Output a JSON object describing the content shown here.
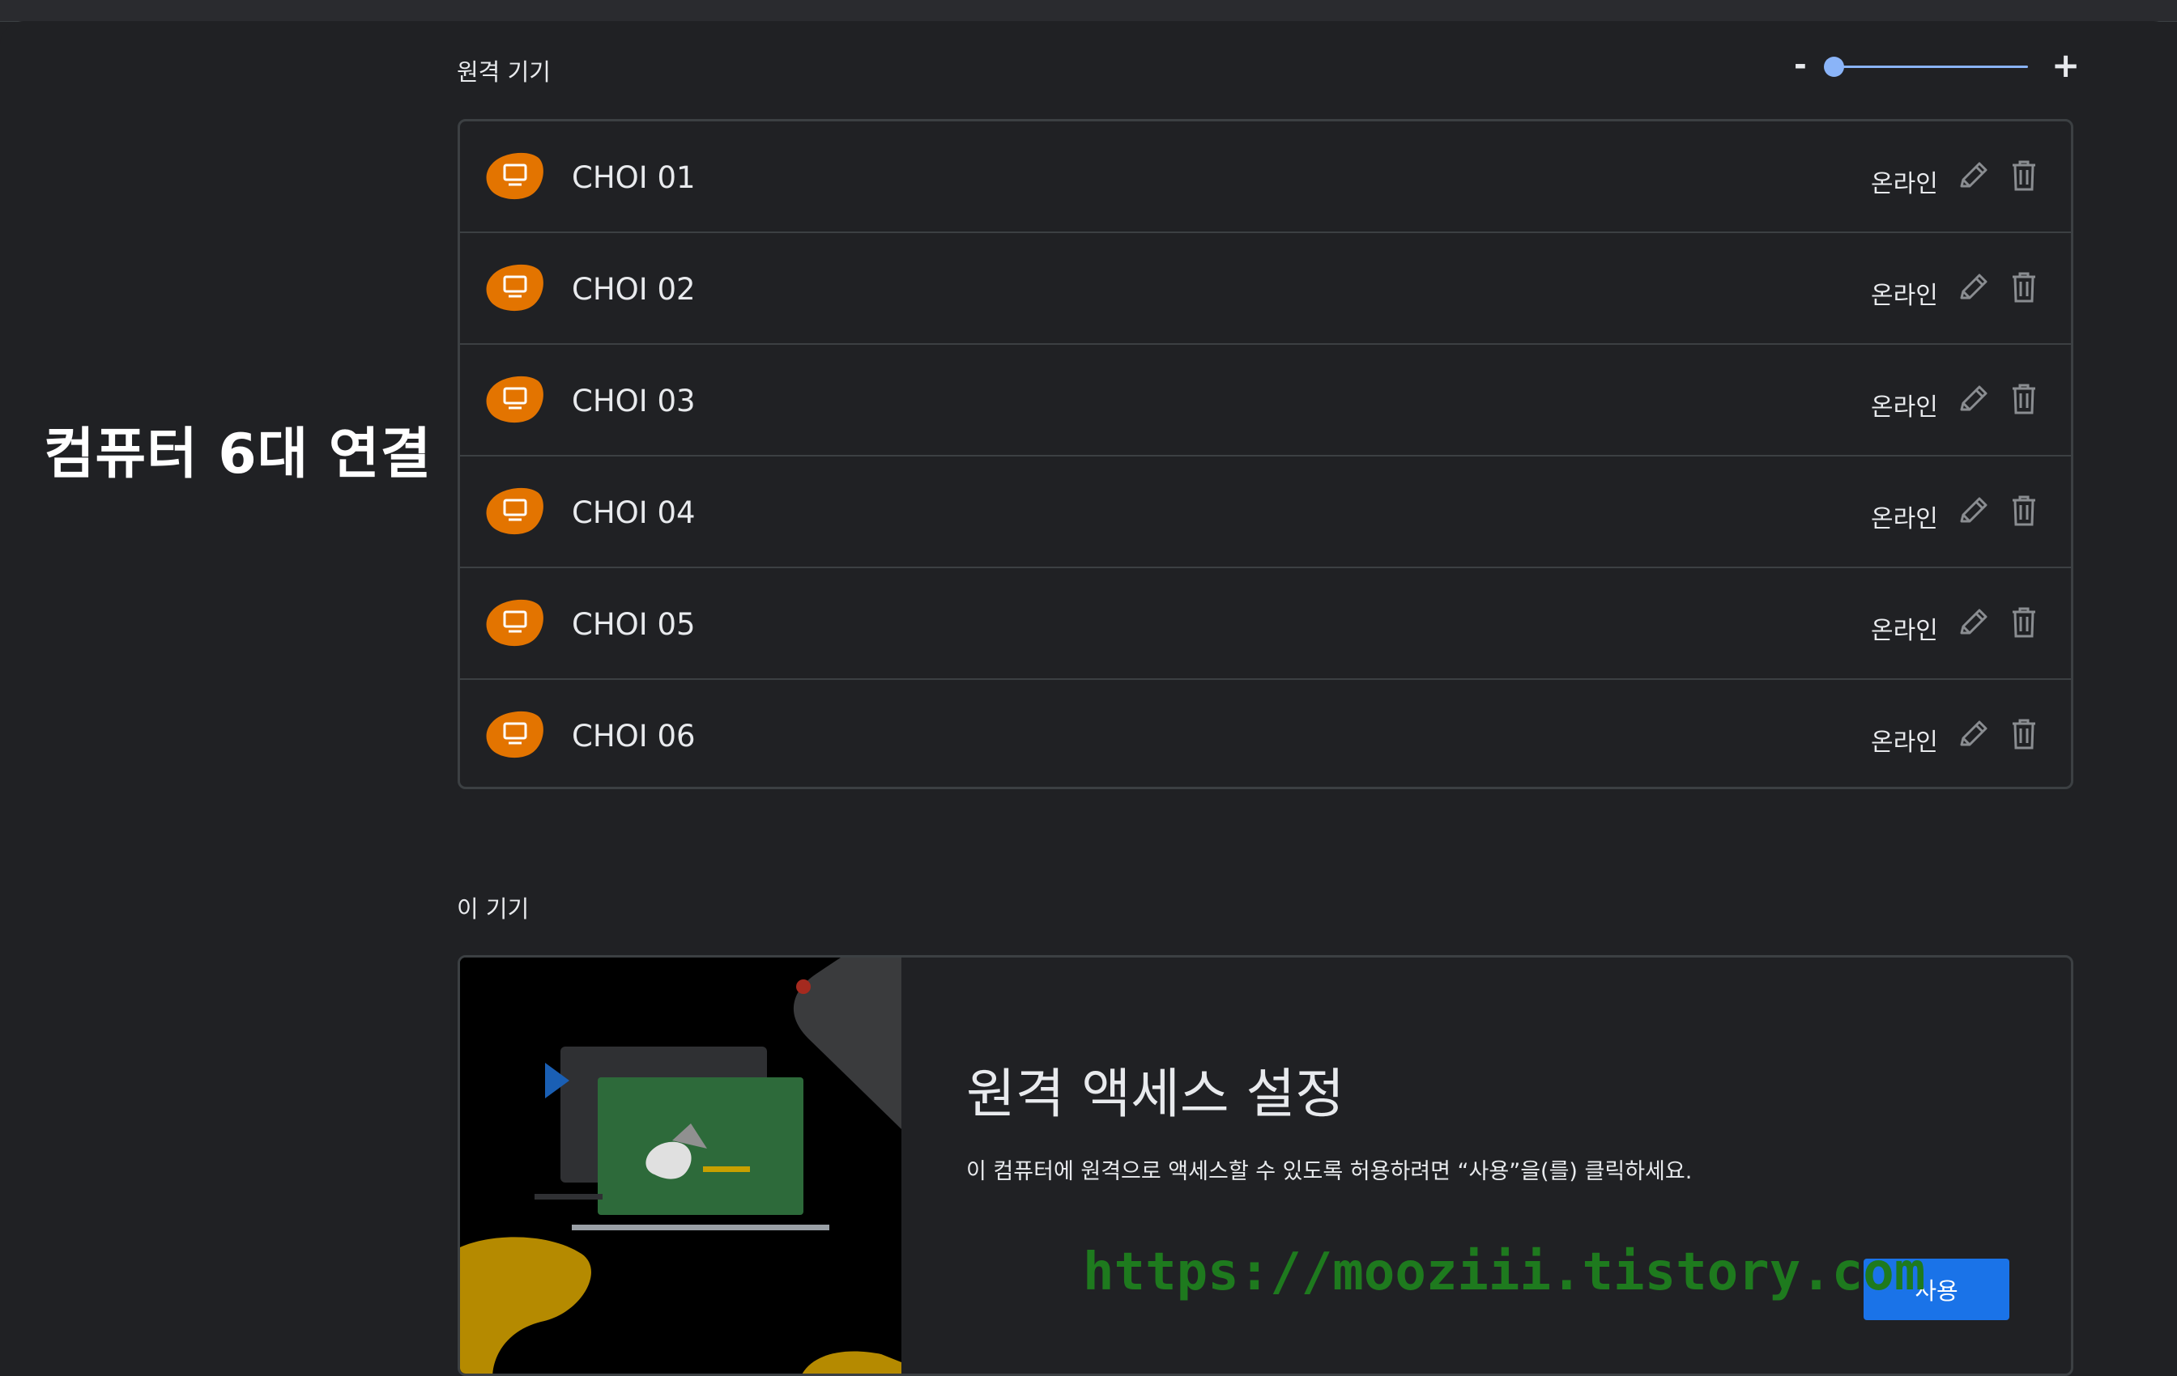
{
  "annotation": {
    "text": "컴퓨터 6대 연결"
  },
  "remote_devices": {
    "title": "원격 기기",
    "zoom": {
      "minus_label": "-",
      "plus_label": "+",
      "level": 0
    },
    "devices": [
      {
        "name": "CHOI 01",
        "status": "온라인"
      },
      {
        "name": "CHOI 02",
        "status": "온라인"
      },
      {
        "name": "CHOI 03",
        "status": "온라인"
      },
      {
        "name": "CHOI 04",
        "status": "온라인"
      },
      {
        "name": "CHOI 05",
        "status": "온라인"
      },
      {
        "name": "CHOI 06",
        "status": "온라인"
      }
    ]
  },
  "this_device": {
    "title": "이 기기",
    "setup_title": "원격 액세스 설정",
    "setup_description": "이 컴퓨터에 원격으로 액세스할 수 있도록 허용하려면 “사용”을(를) 클릭하세요.",
    "enable_label": "사용"
  },
  "watermark": "https://mooziii.tistory.com",
  "colors": {
    "background": "#202124",
    "device_icon": "#e37400",
    "accent": "#1a73e8",
    "slider": "#8ab4f8",
    "watermark": "#1e7a1e"
  },
  "icons": {
    "device": "computer-monitor-icon",
    "edit": "pencil-icon",
    "delete": "trash-icon"
  }
}
